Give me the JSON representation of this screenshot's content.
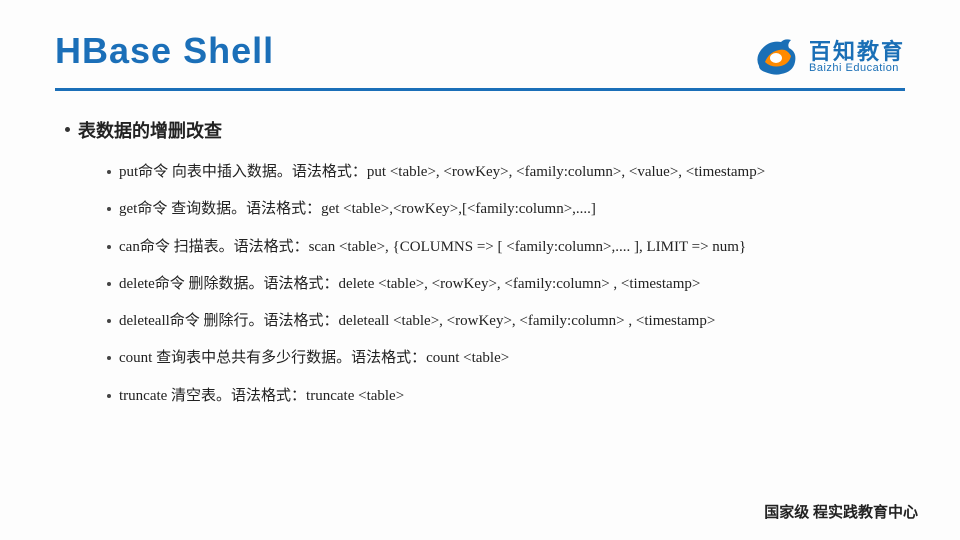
{
  "title": "HBase Shell",
  "logo": {
    "cn": "百知教育",
    "en": "Baizhi Education"
  },
  "section": "表数据的增删改查",
  "items": [
    "put命令 向表中插入数据。语法格式：put <table>, <rowKey>, <family:column>, <value>, <timestamp>",
    "get命令 查询数据。语法格式：get <table>,<rowKey>,[<family:column>,....]",
    "can命令 扫描表。语法格式：scan <table>, {COLUMNS => [ <family:column>,.... ], LIMIT => num}",
    "delete命令 删除数据。语法格式：delete <table>, <rowKey>,  <family:column> , <timestamp>",
    "deleteall命令 删除行。语法格式：deleteall <table>, <rowKey>,  <family:column> , <timestamp>",
    "count 查询表中总共有多少行数据。语法格式：count <table>",
    "truncate 清空表。语法格式：truncate <table>"
  ],
  "footer": "国家级 程实践教育中心"
}
